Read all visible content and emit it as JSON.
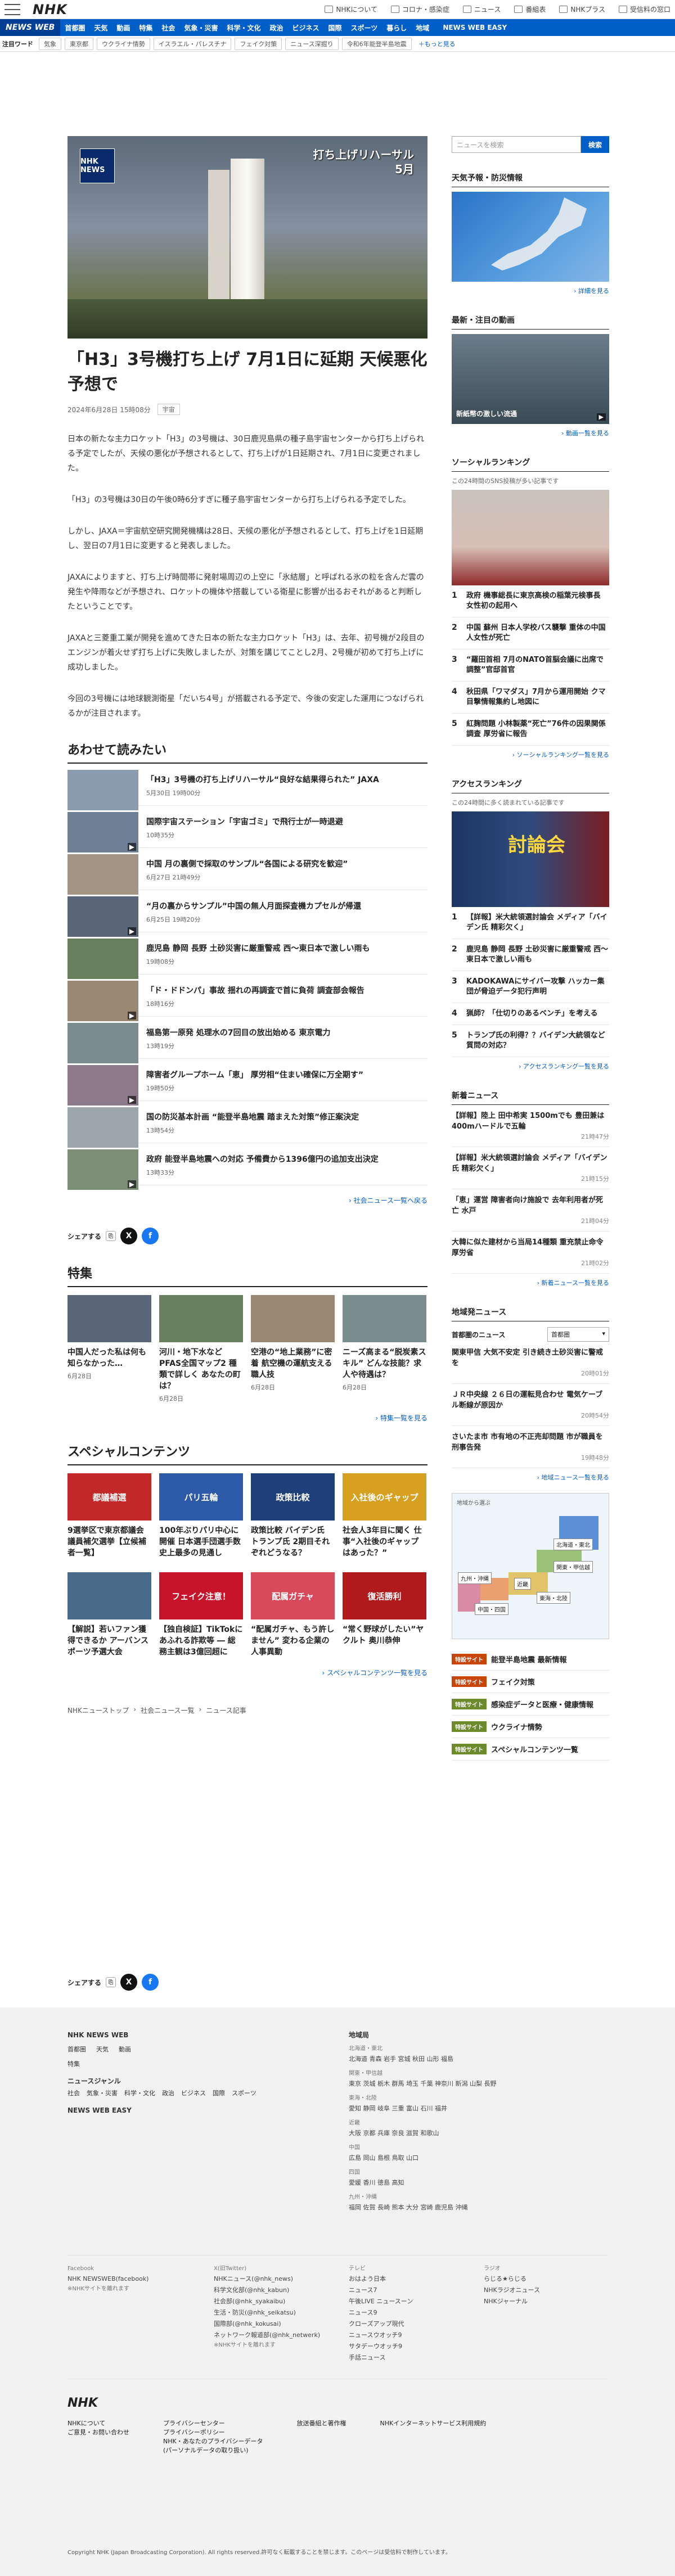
{
  "header": {
    "logo": "NHK",
    "links": [
      "NHKについて",
      "コロナ・感染症",
      "ニュース",
      "番組表",
      "NHKプラス",
      "受信料の窓口"
    ]
  },
  "gnav": {
    "brand": "NEWS WEB",
    "items": [
      "首都圏",
      "天気",
      "動画",
      "特集",
      "社会",
      "気象・災害",
      "科学・文化",
      "政治",
      "ビジネス",
      "国際",
      "スポーツ",
      "暮らし",
      "地域"
    ],
    "easy": "NEWS WEB EASY"
  },
  "tags": {
    "label": "注目ワード",
    "items": [
      "気象",
      "東京都",
      "ウクライナ情勢",
      "イスラエル・パレスチナ",
      "フェイク対策",
      "ニュース深掘り",
      "令和6年能登半島地震"
    ],
    "more": "＋もっと見る"
  },
  "article": {
    "hero_logo": "NHK NEWS",
    "hero_caption_1": "打ち上げリハーサル",
    "hero_caption_2": "5月",
    "title": "「H3」3号機打ち上げ 7月1日に延期 天候悪化予想で",
    "date": "2024年6月28日 15時08分",
    "category": "宇宙",
    "paragraphs": [
      "日本の新たな主力ロケット「H3」の3号機は、30日鹿児島県の種子島宇宙センターから打ち上げられる予定でしたが、天候の悪化が予想されるとして、打ち上げが1日延期され、7月1日に変更されました。",
      "「H3」の3号機は30日の午後0時6分すぎに種子島宇宙センターから打ち上げられる予定でした。",
      "しかし、JAXA＝宇宙航空研究開発機構は28日、天候の悪化が予想されるとして、打ち上げを1日延期し、翌日の7月1日に変更すると発表しました。",
      "JAXAによりますと、打ち上げ時間帯に発射場周辺の上空に「氷結層」と呼ばれる氷の粒を含んだ雲の発生や降雨などが予想され、ロケットの機体や搭載している衛星に影響が出るおそれがあると判断したということです。",
      "JAXAと三菱重工業が開発を進めてきた日本の新たな主力ロケット「H3」は、去年、初号機が2段目のエンジンが着火せず打ち上げに失敗しましたが、対策を講じてことし2月、2号機が初めて打ち上げに成功しました。",
      "今回の3号機には地球観測衛星「だいち4号」が搭載される予定で、今後の安定した運用につなげられるかが注目されます。"
    ]
  },
  "related": {
    "heading": "あわせて読みたい",
    "items": [
      {
        "title": "「H3」3号機の打ち上げリハーサル“良好な結果得られた” JAXA",
        "date": "5月30日 19時00分"
      },
      {
        "title": "国際宇宙ステーション「宇宙ゴミ」で飛行士が一時退避",
        "date": "10時35分"
      },
      {
        "title": "中国 月の裏側で採取のサンプル“各国による研究を歓迎”",
        "date": "6月27日 21時49分"
      },
      {
        "title": "“月の裏からサンプル”中国の無人月面探査機カプセルが帰還",
        "date": "6月25日 19時20分"
      },
      {
        "title": "鹿児島 静岡 長野 土砂災害に厳重警戒 西～東日本で激しい雨も",
        "date": "19時08分"
      },
      {
        "title": "「ド・ドドンパ」事故 揺れの再調査で首に負荷 調査部会報告",
        "date": "18時16分"
      },
      {
        "title": "福島第一原発 処理水の7回目の放出始める 東京電力",
        "date": "13時19分"
      },
      {
        "title": "障害者グループホーム「恵」 厚労相“住まい確保に万全期す”",
        "date": "19時50分"
      },
      {
        "title": "国の防災基本計画 “能登半島地震 踏まえた対策”修正案決定",
        "date": "13時54分"
      },
      {
        "title": "政府 能登半島地震への対応 予備費から1396億円の追加支出決定",
        "date": "13時33分"
      }
    ],
    "more": "社会ニュース一覧へ戻る"
  },
  "share": {
    "label": "シェアする"
  },
  "tokushu": {
    "heading": "特集",
    "items": [
      {
        "title": "中国人だった私は何も知らなかった…",
        "date": "6月28日"
      },
      {
        "title": "河川・地下水など PFAS全国マップ2 種類で詳しく あなたの町は？",
        "date": "6月28日"
      },
      {
        "title": "空港の“地上業務”に密着 航空機の運航支える職人技",
        "date": "6月28日"
      },
      {
        "title": "ニーズ高まる“脱炭素スキル” どんな技能？求人や待遇は？",
        "date": "6月28日"
      }
    ],
    "more": "特集一覧を見る"
  },
  "special": {
    "heading": "スペシャルコンテンツ",
    "items": [
      {
        "title": "9選挙区で東京都議会議員補欠選挙【立候補者一覧】",
        "img": "都議補選"
      },
      {
        "title": "100年ぶりパリ中心に開催 日本選手団選手数 史上最多の見通し",
        "img": "パリ五輪"
      },
      {
        "title": "政策比較 バイデン氏 トランプ氏 2期目それぞれどうなる？",
        "img": "政策比較"
      },
      {
        "title": "社会人3年目に聞く 仕事“入社後のギャップはあった？”",
        "img": "入社後のギャップ"
      },
      {
        "title": "【解説】若いファン獲得できるか アーバンスポーツ予選大会",
        "img": ""
      },
      {
        "title": "【独自検証】TikTokにあふれる詐欺等 ― 総務主観は3億回超に",
        "img": "フェイク注意！"
      },
      {
        "title": "“配属ガチャ、もう許しません” 変わる企業の人事異動",
        "img": "配属ガチャ"
      },
      {
        "title": "“常く野球がしたい”ヤクルト 奥川恭伸",
        "img": "復活勝利"
      }
    ],
    "more": "スペシャルコンテンツ一覧を見る"
  },
  "breadcrumb": [
    "NHKニューストップ",
    "社会ニュース一覧",
    "ニュース記事"
  ],
  "side": {
    "search_placeholder": "ニュースを検索",
    "search_button": "検索",
    "weather": {
      "heading": "天気予報・防災情報",
      "more": "詳細を見る"
    },
    "video": {
      "heading": "最新・注目の動画",
      "caption": "新紙幣の激しい流通",
      "more": "動画一覧を見る"
    },
    "social": {
      "heading": "ソーシャルランキング",
      "sub": "この24時間のSNS投稿が多い記事です",
      "items": [
        "政府 機事総長に東京高検の稲葉元検事長 女性初の起用へ",
        "中国 蘇州 日本人学校バス襲撃 重体の中国人女性が死亡",
        "“羅田首相 7月のNATO首脳会議に出席で調整”官邸首官",
        "秋田県「ワマダス」7月から運用開始 クマ目撃情報集約し地図に",
        "紅麹問題 小林製薬“死亡”76件の因果関係調査 厚労省に報告"
      ],
      "more": "ソーシャルランキング一覧を見る"
    },
    "access": {
      "heading": "アクセスランキング",
      "sub": "この24時間に多く読まれている記事です",
      "img": "討論会",
      "items": [
        "【詳報】米大統領選討論会 メディア「バイデン氏 精彩欠く」",
        "鹿児島 静岡 長野 土砂災害に厳重警戒 西～東日本で激しい雨も",
        "KADOKAWAにサイバー攻撃 ハッカー集団が脅迫データ犯行声明",
        "猟師？「仕切りのあるベンチ」を考える",
        "トランプ氏の利得？？バイデン大統領など質問の対応？"
      ],
      "more": "アクセスランキング一覧を見る"
    },
    "latest": {
      "heading": "新着ニュース",
      "items": [
        {
          "title": "【詳報】陸上 田中希実 1500mでも 豊田兼は400mハードルで五輪",
          "date": "21時47分"
        },
        {
          "title": "【詳報】米大統領選討論会 メディア「バイデン氏 精彩欠く」",
          "date": "21時15分"
        },
        {
          "title": "「恵」運営 障害者向け施設で 去年利用者が死亡 水戸",
          "date": "21時04分"
        },
        {
          "title": "大韓に似た建材から当局14種類 重充禁止命令 厚労省",
          "date": "21時02分"
        }
      ],
      "more": "新着ニュース一覧を見る"
    },
    "area": {
      "heading": "地域発ニュース",
      "label": "首都圏のニュース",
      "select": "首都圏",
      "items": [
        {
          "title": "関東甲信 大気不安定 引き続き土砂災害に警戒を",
          "date": "20時01分"
        },
        {
          "title": "ＪＲ中央線 ２６日の運転見合わせ 電気ケーブル断線が原因か",
          "date": "20時54分"
        },
        {
          "title": "さいたま市 市有地の不正売却問題 市が職員を刑事告発",
          "date": "19時48分"
        }
      ],
      "more": "地域ニュース一覧を見る"
    },
    "map": {
      "label": "地域から選ぶ",
      "regions": [
        "北海道・東北",
        "関東・甲信越",
        "近畿",
        "九州・沖縄",
        "中国・四国",
        "東海・北陸"
      ]
    },
    "banners": [
      {
        "badge": "特設サイト",
        "text": "能登半島地震 最新情報"
      },
      {
        "badge": "特設サイト",
        "text": "フェイク対策"
      },
      {
        "badge": "特設サイト",
        "text": "感染症データと医療・健康情報"
      },
      {
        "badge": "特設サイト",
        "text": "ウクライナ情勢"
      },
      {
        "badge": "特設サイト",
        "text": "スペシャルコンテンツ一覧"
      }
    ]
  },
  "footer": {
    "share": "シェアする",
    "col1_title": "NHK NEWS WEB",
    "col1_row1": [
      "首都圏",
      "天気",
      "動画"
    ],
    "col1_row2": "特集",
    "col1_genre_title": "ニュースジャンル",
    "col1_genre": [
      "社会",
      "気象・災害",
      "科学・文化",
      "政治",
      "ビジネス",
      "国際",
      "スポーツ"
    ],
    "col1_easy": "NEWS WEB EASY",
    "col2_title": "地域局",
    "regions": [
      {
        "name": "北海道・東北",
        "list": "北海道 青森 岩手 宮城 秋田 山形 福島"
      },
      {
        "name": "関東・甲信越",
        "list": "東京 茨城 栃木 群馬 埼玉 千葉 神奈川 新潟 山梨 長野"
      },
      {
        "name": "東海・北陸",
        "list": "愛知 静岡 岐阜 三重 富山 石川 福井"
      },
      {
        "name": "近畿",
        "list": "大阪 京都 兵庫 奈良 滋賀 和歌山"
      },
      {
        "name": "中国",
        "list": "広島 岡山 島根 鳥取 山口"
      },
      {
        "name": "四国",
        "list": "愛媛 香川 徳島 高知"
      },
      {
        "name": "九州・沖縄",
        "list": "福岡 佐賀 長崎 熊本 大分 宮崎 鹿児島 沖縄"
      }
    ],
    "sns": [
      {
        "title": "Facebook",
        "items": [
          "NHK NEWSWEB(facebook)",
          "※NHKサイトを離れます"
        ]
      },
      {
        "title": "X(旧Twitter)",
        "items": [
          "NHKニュース(@nhk_news)",
          "科学文化部(@nhk_kabun)",
          "社会部(@nhk_syakaibu)",
          "生活・防災(@nhk_seikatsu)",
          "国際部(@nhk_kokusai)",
          "ネットワーク報道部(@nhk_netwerk)",
          "※NHKサイトを離れます"
        ]
      },
      {
        "title": "テレビ",
        "items": [
          "おはよう日本",
          "ニュース7",
          "午後LIVE ニュースーン",
          "ニュース9",
          "クローズアップ現代",
          "ニュースウオッチ9",
          "サタデーウオッチ9",
          "手話ニュース"
        ]
      },
      {
        "title": "ラジオ",
        "items": [
          "らじる★らじる",
          "NHKラジオニュース",
          "NHKジャーナル"
        ]
      }
    ],
    "bottom_logo": "NHK",
    "bottom_links1": [
      "NHKについて",
      "ご意見・お問い合わせ"
    ],
    "bottom_links2": [
      "プライバシーセンター",
      "プライバシーポリシー",
      "NHK・あなたのプライバシーデータ",
      "(パーソナルデータの取り扱い)"
    ],
    "bottom_links3": [
      "放送番組と著作権"
    ],
    "bottom_links4": [
      "NHKインターネットサービス利用規約"
    ],
    "copyright": "Copyright NHK (Japan Broadcasting Corporation). All rights reserved.許可なく転載することを禁じます。このページは受信料で制作しています。"
  }
}
